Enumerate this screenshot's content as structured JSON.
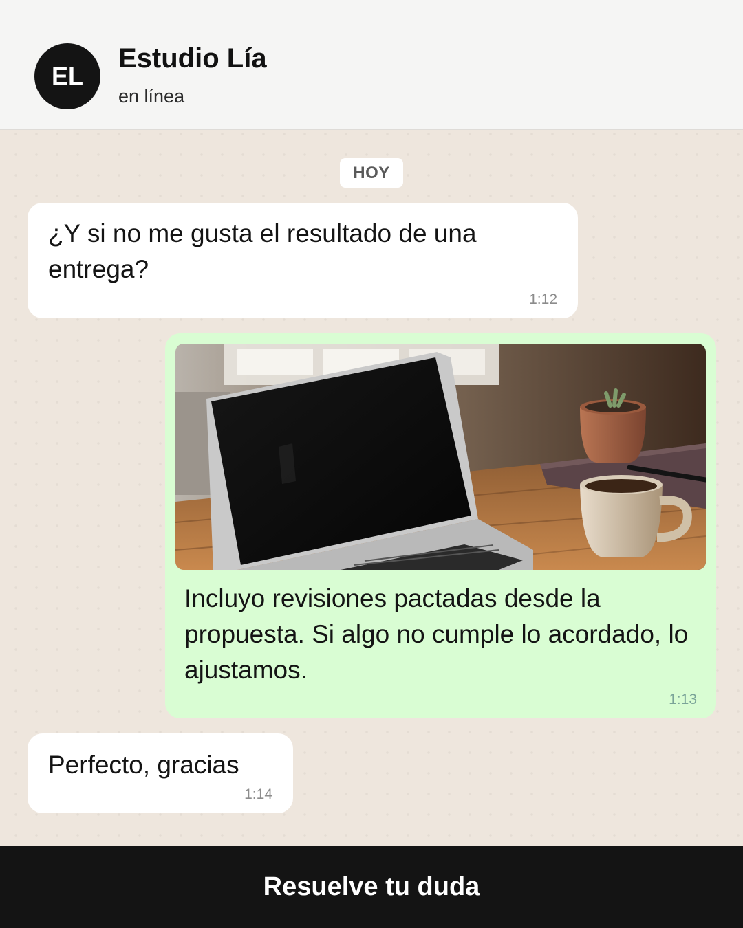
{
  "chat_header": {
    "avatar_initials": "EL",
    "contact_name": "Estudio Lía",
    "status": "en línea"
  },
  "date_separator": "HOY",
  "messages": [
    {
      "direction": "incoming",
      "text": "¿Y si no me gusta el resultado de una entrega?",
      "time": "1:12"
    },
    {
      "direction": "outgoing",
      "image": "laptop-coffee-desk-photo",
      "text": "Incluyo revisiones pactadas desde la propuesta. Si algo no cumple lo acordado, lo ajustamos.",
      "time": "1:13"
    },
    {
      "direction": "incoming",
      "text": "Perfecto, gracias",
      "time": "1:14"
    }
  ],
  "cta": {
    "label": "Resuelve tu duda"
  },
  "colors": {
    "chat_background": "#eee6dd",
    "header_background": "#f5f5f4",
    "incoming_bubble": "#ffffff",
    "outgoing_bubble": "#d9fdd3",
    "dark": "#141414"
  }
}
